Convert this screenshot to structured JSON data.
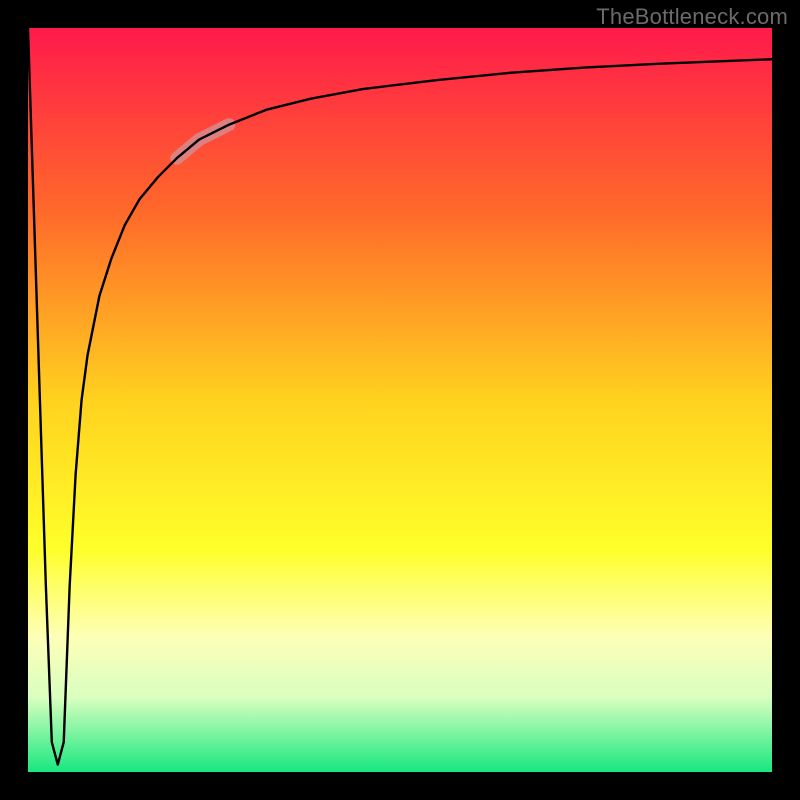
{
  "watermark": "TheBottleneck.com",
  "chart_data": {
    "type": "line",
    "title": "",
    "xlabel": "",
    "ylabel": "",
    "xlim": [
      0,
      100
    ],
    "ylim": [
      0,
      100
    ],
    "grid": false,
    "legend": false,
    "background_gradient": {
      "stops": [
        {
          "offset": 0.0,
          "color": "#ff1a4b"
        },
        {
          "offset": 0.25,
          "color": "#ff6a2a"
        },
        {
          "offset": 0.5,
          "color": "#ffd21f"
        },
        {
          "offset": 0.7,
          "color": "#ffff2a"
        },
        {
          "offset": 0.82,
          "color": "#fdffb8"
        },
        {
          "offset": 0.9,
          "color": "#d9ffbf"
        },
        {
          "offset": 1.0,
          "color": "#17e880"
        }
      ]
    },
    "series": [
      {
        "name": "curve",
        "x": [
          0.0,
          0.8,
          1.6,
          2.4,
          3.2,
          4.0,
          4.8,
          5.6,
          6.4,
          7.2,
          8.0,
          9.6,
          11.2,
          13.0,
          15.0,
          17.5,
          20.0,
          23.0,
          27.0,
          32.0,
          38.0,
          45.0,
          55.0,
          65.0,
          75.0,
          85.0,
          100.0
        ],
        "y": [
          100.0,
          75.0,
          50.0,
          25.0,
          4.0,
          1.0,
          4.0,
          25.0,
          40.0,
          50.0,
          56.0,
          64.0,
          69.0,
          73.5,
          77.0,
          80.0,
          82.5,
          85.0,
          87.0,
          89.0,
          90.5,
          91.8,
          93.0,
          94.0,
          94.7,
          95.2,
          95.8
        ]
      }
    ],
    "highlight": {
      "series": "curve",
      "x_range": [
        20.0,
        27.0
      ],
      "color": "#d68a8e",
      "width": 13
    }
  }
}
